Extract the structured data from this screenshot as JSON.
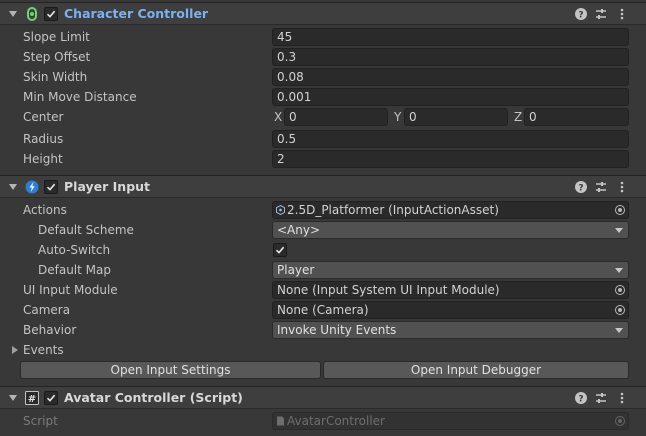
{
  "character_controller": {
    "title": "Character Controller",
    "enabled": true,
    "fields": {
      "slope_limit": {
        "label": "Slope Limit",
        "value": "45"
      },
      "step_offset": {
        "label": "Step Offset",
        "value": "0.3"
      },
      "skin_width": {
        "label": "Skin Width",
        "value": "0.08"
      },
      "min_move_distance": {
        "label": "Min Move Distance",
        "value": "0.001"
      },
      "center": {
        "label": "Center",
        "x_label": "X",
        "x": "0",
        "y_label": "Y",
        "y": "0",
        "z_label": "Z",
        "z": "0"
      },
      "radius": {
        "label": "Radius",
        "value": "0.5"
      },
      "height": {
        "label": "Height",
        "value": "2"
      }
    }
  },
  "player_input": {
    "title": "Player Input",
    "enabled": true,
    "actions": {
      "label": "Actions",
      "value": "2.5D_Platformer (InputActionAsset)"
    },
    "default_scheme": {
      "label": "Default Scheme",
      "value": "<Any>"
    },
    "auto_switch": {
      "label": "Auto-Switch",
      "checked": true
    },
    "default_map": {
      "label": "Default Map",
      "value": "Player"
    },
    "ui_input_module": {
      "label": "UI Input Module",
      "value": "None (Input System UI Input Module)"
    },
    "camera": {
      "label": "Camera",
      "value": "None (Camera)"
    },
    "behavior": {
      "label": "Behavior",
      "value": "Invoke Unity Events"
    },
    "events": {
      "label": "Events"
    },
    "open_input_settings": "Open Input Settings",
    "open_input_debugger": "Open Input Debugger"
  },
  "avatar_controller": {
    "title": "Avatar Controller (Script)",
    "enabled": true,
    "script": {
      "label": "Script",
      "value": "AvatarController"
    }
  },
  "icons": {
    "help": "help-icon",
    "presets": "presets-icon",
    "menu": "kebab-menu-icon",
    "character_controller": "character-controller-icon",
    "player_input": "player-input-icon",
    "script": "script-hash-icon"
  },
  "colors": {
    "background": "#383838",
    "header": "#3e3e3e",
    "field": "#2a2a2a",
    "selected_title": "#7cb1f0",
    "dropdown": "#515151",
    "button": "#585858"
  }
}
